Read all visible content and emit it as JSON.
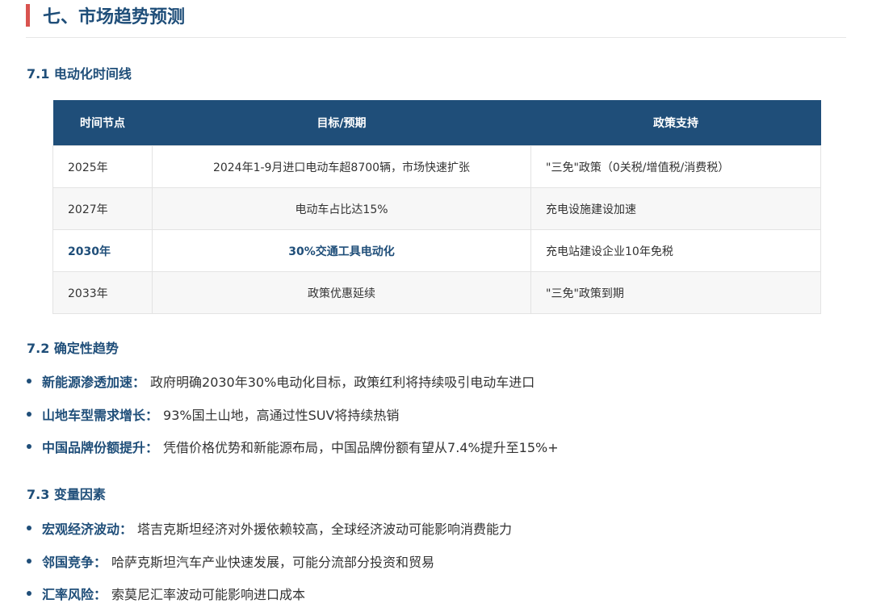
{
  "section": {
    "title": "七、市场趋势预测"
  },
  "s1": {
    "title": "7.1 电动化时间线",
    "headers": [
      "时间节点",
      "目标/预期",
      "政策支持"
    ],
    "rows": [
      [
        "2025年",
        "2024年1-9月进口电动车超8700辆，市场快速扩张",
        "\"三免\"政策（0关税/增值税/消费税）"
      ],
      [
        "2027年",
        "电动车占比达15%",
        "充电设施建设加速"
      ],
      [
        "2030年",
        "30%交通工具电动化",
        "充电站建设企业10年免税"
      ],
      [
        "2033年",
        "政策优惠延续",
        "\"三免\"政策到期"
      ]
    ]
  },
  "s2": {
    "title": "7.2 确定性趋势",
    "items": [
      {
        "label": "新能源渗透加速：",
        "text": "政府明确2030年30%电动化目标，政策红利将持续吸引电动车进口"
      },
      {
        "label": "山地车型需求增长：",
        "text": "93%国土山地，高通过性SUV将持续热销"
      },
      {
        "label": "中国品牌份额提升：",
        "text": "凭借价格优势和新能源布局，中国品牌份额有望从7.4%提升至15%+"
      }
    ]
  },
  "s3": {
    "title": "7.3 变量因素",
    "items": [
      {
        "label": "宏观经济波动：",
        "text": "塔吉克斯坦经济对外援依赖较高，全球经济波动可能影响消费能力"
      },
      {
        "label": "邻国竞争：",
        "text": "哈萨克斯坦汽车产业快速发展，可能分流部分投资和贸易"
      },
      {
        "label": "汇率风险：",
        "text": "索莫尼汇率波动可能影响进口成本"
      }
    ]
  },
  "colors": {
    "accent": "#1f4e79",
    "marker": "#d9534f"
  }
}
